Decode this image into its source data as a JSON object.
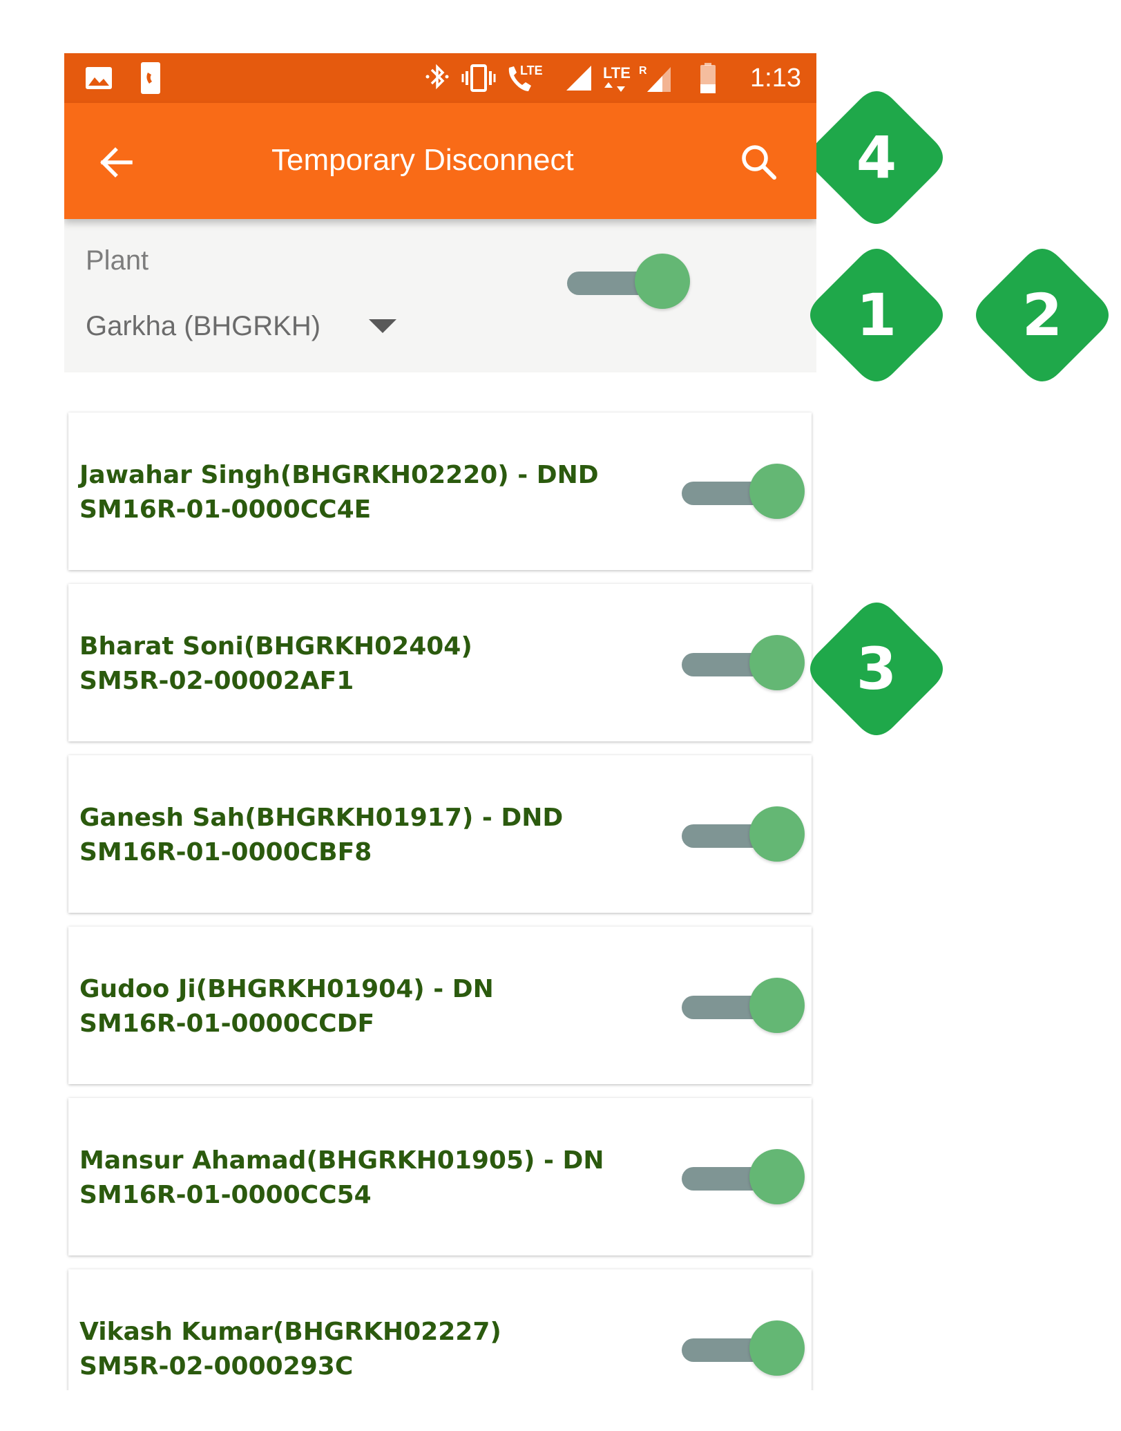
{
  "status_bar": {
    "icons": [
      "image-icon",
      "phone-screen-icon",
      "bluetooth-icon",
      "vibrate-icon",
      "volte-call-icon",
      "signal-icon",
      "lte-data-icon",
      "roaming-signal-icon",
      "battery-low-icon"
    ],
    "volte_label": "LTE",
    "lte_label": "LTE",
    "roaming_label": "R",
    "time": "1:13"
  },
  "app_bar": {
    "title": "Temporary Disconnect",
    "back_icon": "arrow-back-icon",
    "search_icon": "search-icon"
  },
  "filter": {
    "label": "Plant",
    "selected": "Garkha (BHGRKH)",
    "toggle_on": true
  },
  "consumers": [
    {
      "name": "Jawahar Singh(BHGRKH02220) - DND",
      "meter": "SM16R-01-0000CC4E",
      "toggle_on": true
    },
    {
      "name": "Bharat Soni(BHGRKH02404)",
      "meter": "SM5R-02-00002AF1",
      "toggle_on": true
    },
    {
      "name": "Ganesh Sah(BHGRKH01917) - DND",
      "meter": "SM16R-01-0000CBF8",
      "toggle_on": true
    },
    {
      "name": "Gudoo Ji(BHGRKH01904) - DN",
      "meter": "SM16R-01-0000CCDF",
      "toggle_on": true
    },
    {
      "name": "Mansur Ahamad(BHGRKH01905) - DN",
      "meter": "SM16R-01-0000CC54",
      "toggle_on": true
    },
    {
      "name": "Vikash Kumar(BHGRKH02227)",
      "meter": "SM5R-02-0000293C",
      "toggle_on": true
    }
  ],
  "annotations": [
    {
      "label": "4"
    },
    {
      "label": "1"
    },
    {
      "label": "2"
    },
    {
      "label": "3"
    }
  ],
  "colors": {
    "status_bar": "#E55A0E",
    "app_bar": "#F96B17",
    "consumer_text": "#2B5A0E",
    "toggle_thumb": "#64B774",
    "toggle_track": "#7F9594",
    "badge": "#1FA84A"
  }
}
